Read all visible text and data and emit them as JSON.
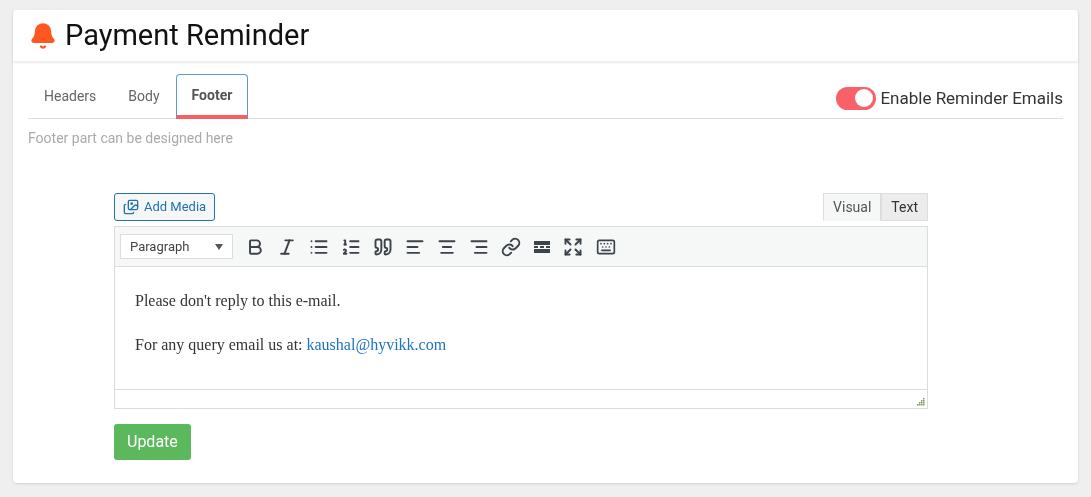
{
  "header": {
    "title": "Payment Reminder"
  },
  "tabs": [
    {
      "label": "Headers",
      "selected": false
    },
    {
      "label": "Body",
      "selected": false
    },
    {
      "label": "Footer",
      "selected": true
    }
  ],
  "toggle": {
    "label": "Enable Reminder Emails",
    "on": true
  },
  "hint": "Footer part can be designed here",
  "editor": {
    "add_media": "Add Media",
    "modes": [
      {
        "label": "Visual",
        "selected": true
      },
      {
        "label": "Text",
        "selected": false
      }
    ],
    "format": "Paragraph",
    "paragraphs": [
      {
        "text": "Please don't reply to this e-mail."
      },
      {
        "text": "For any query email us at: ",
        "link": "kaushal@hyvikk.com"
      }
    ]
  },
  "update_button": "Update"
}
